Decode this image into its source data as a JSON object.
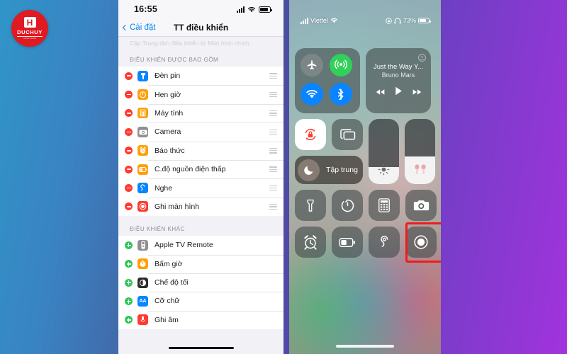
{
  "brand": {
    "mark": "H",
    "name": "DUCHUY",
    "tagline": "CONG NGHE",
    "color": "#e01a22"
  },
  "left_phone": {
    "status": {
      "time": "16:55",
      "signal_icon": "cellular-signal-icon",
      "wifi_icon": "wifi-icon",
      "battery_icon": "battery-icon"
    },
    "nav": {
      "back_label": "Cài đặt",
      "title": "TT điều khiển"
    },
    "faded_text": "Cập Trung tâm điều khiển từ Màn hình chính.",
    "sections": [
      {
        "header": "ĐIỀU KHIỂN ĐƯỢC BAO GỒM",
        "action": "remove",
        "items": [
          {
            "label": "Đèn pin",
            "icon": "flashlight-icon",
            "icon_bg": "#0a84ff",
            "glyph": "🔦"
          },
          {
            "label": "Hẹn giờ",
            "icon": "timer-icon",
            "icon_bg": "#ff9f0a",
            "glyph": "⏱"
          },
          {
            "label": "Máy tính",
            "icon": "calculator-icon",
            "icon_bg": "#ff9f0a",
            "glyph": "▦"
          },
          {
            "label": "Camera",
            "icon": "camera-icon",
            "icon_bg": "#8e8e93",
            "glyph": "◉"
          },
          {
            "label": "Báo thức",
            "icon": "alarm-icon",
            "icon_bg": "#ff9f0a",
            "glyph": "⏰"
          },
          {
            "label": "C.độ nguồn điện thấp",
            "icon": "low-power-icon",
            "icon_bg": "#ff9f0a",
            "glyph": "▭"
          },
          {
            "label": "Nghe",
            "icon": "hearing-icon",
            "icon_bg": "#0a84ff",
            "glyph": "👂"
          },
          {
            "label": "Ghi màn hình",
            "icon": "screen-record-icon",
            "icon_bg": "#ff3b30",
            "glyph": "◉"
          }
        ]
      },
      {
        "header": "ĐIỀU KHIỂN KHÁC",
        "action": "add",
        "items": [
          {
            "label": "Apple TV Remote",
            "icon": "apple-tv-remote-icon",
            "icon_bg": "#8e8e93",
            "glyph": "▯"
          },
          {
            "label": "Bấm giờ",
            "icon": "stopwatch-icon",
            "icon_bg": "#ff9f0a",
            "glyph": "◔"
          },
          {
            "label": "Chế độ tối",
            "icon": "dark-mode-icon",
            "icon_bg": "#2c2c2e",
            "glyph": "◐"
          },
          {
            "label": "Cỡ chữ",
            "icon": "text-size-icon",
            "icon_bg": "#0a84ff",
            "glyph": "AA"
          },
          {
            "label": "Ghi âm",
            "icon": "voice-memo-icon",
            "icon_bg": "#ff3b30",
            "glyph": "⏺"
          }
        ]
      }
    ]
  },
  "right_phone": {
    "status": {
      "carrier": "Viettel",
      "battery_percent": "73%",
      "lock_icon": "rotation-lock-icon",
      "headphones_icon": "headphones-icon",
      "wifi_icon": "wifi-icon"
    },
    "connectivity": [
      {
        "name": "airplane-mode-toggle",
        "glyph": "✈",
        "state": "off",
        "color": "#82868a"
      },
      {
        "name": "cellular-data-toggle",
        "glyph": "((·))",
        "state": "on",
        "color": "#30d158"
      },
      {
        "name": "wifi-toggle",
        "glyph": "wifi",
        "state": "on",
        "color": "#0a84ff"
      },
      {
        "name": "bluetooth-toggle",
        "glyph": "bluetooth",
        "state": "on",
        "color": "#0a84ff"
      }
    ],
    "music": {
      "title": "Just the Way Y...",
      "artist": "Bruno Mars",
      "prev": "⏪",
      "play": "▶",
      "next": "⏩",
      "airplay": "airplay-icon"
    },
    "rotation_lock": {
      "name": "rotation-lock-tile",
      "state": "on"
    },
    "screen_mirroring": {
      "name": "screen-mirroring-tile"
    },
    "focus": {
      "label": "Tập trung",
      "icon": "moon-icon"
    },
    "brightness": {
      "name": "brightness-slider",
      "level_percent": 26,
      "icon": "sun-icon"
    },
    "volume": {
      "name": "volume-slider",
      "level_percent": 42,
      "icon": "airpods-icon"
    },
    "tiles": [
      {
        "label": "",
        "name": "flashlight-tile",
        "glyph": "flashlight"
      },
      {
        "label": "",
        "name": "timer-tile",
        "glyph": "timer"
      },
      {
        "label": "",
        "name": "calculator-tile",
        "glyph": "calculator"
      },
      {
        "label": "",
        "name": "camera-tile",
        "glyph": "camera"
      },
      {
        "label": "",
        "name": "alarm-tile",
        "glyph": "alarm"
      },
      {
        "label": "",
        "name": "low-power-tile",
        "glyph": "battery"
      },
      {
        "label": "",
        "name": "hearing-tile",
        "glyph": "ear"
      },
      {
        "label": "",
        "name": "screen-record-tile",
        "glyph": "record",
        "highlighted": true
      }
    ],
    "highlight_color": "#ee1d1d"
  }
}
